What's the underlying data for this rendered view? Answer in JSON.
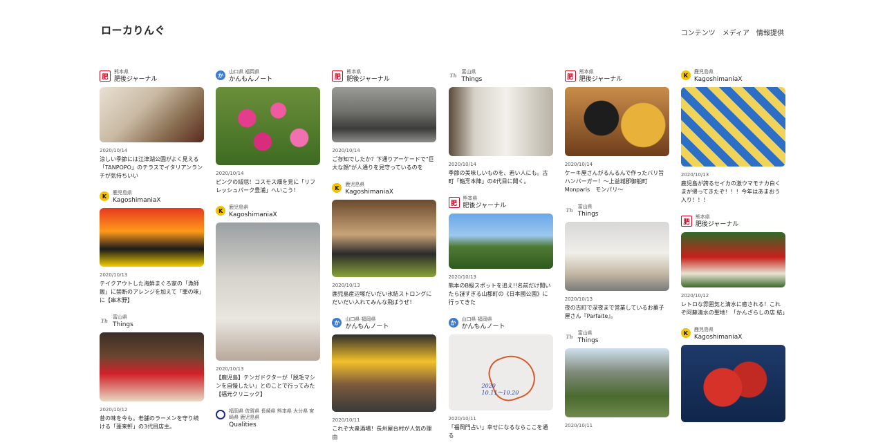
{
  "header": {
    "title": "ローカりんぐ",
    "nav": [
      "コンテンツ",
      "メディア",
      "情報提供"
    ]
  },
  "columns": [
    [
      {
        "pref": "熊本県",
        "name": "肥後ジャーナル",
        "logo": "higo",
        "date": "2020/10/14",
        "title": "涼しい季節には江津湖公園がよく見える「TANPOPO」のテラスでイタリアンランチが気持ちいい"
      },
      {
        "pref": "鹿児島県",
        "name": "KagoshimaniaX",
        "logo": "kago",
        "date": "2020/10/13",
        "title": "テイクアウトした海鮮まぐろ家の「漁師飯」に禁断のアレンジを加えて「罪の味」に【串木野】"
      },
      {
        "pref": "富山県",
        "name": "Things",
        "logo": "things",
        "date": "2020/10/12",
        "title": "昔の味を今も。老舗のラーメンを守り続ける「蓬来軒」の3代目店主。"
      }
    ],
    [
      {
        "pref": "山口県 福岡県",
        "name": "かんもんノート",
        "logo": "kanmon",
        "date": "2020/10/14",
        "title": "ピンクの絨毯！コスモス畑を見に「リフレッシュパーク豊浦」へいこう！"
      },
      {
        "pref": "鹿児島県",
        "name": "KagoshimaniaX",
        "logo": "kago",
        "date": "2020/10/13",
        "title": "【鹿児島】テンガドクターが「脱毛マシンを自慢したい」とのことで行ってみた【福元クリニック】"
      },
      {
        "pref": "福岡県 佐賀県 長崎県 熊本県 大分県 宮崎県 鹿児島県",
        "name": "Qualities",
        "logo": "qual",
        "date": "",
        "title": ""
      }
    ],
    [
      {
        "pref": "熊本県",
        "name": "肥後ジャーナル",
        "logo": "higo",
        "date": "2020/10/14",
        "title": "ご存知でしたか？下通りアーケードで\"巨大な顔\"が人通りを見守っているのを"
      },
      {
        "pref": "鹿児島県",
        "name": "KagoshimaniaX",
        "logo": "kago",
        "date": "2020/10/13",
        "title": "鹿児島産辺塚だいだい氷結ストロングにだいだい入れてみんな飛ばうぜ！"
      },
      {
        "pref": "山口県 福岡県",
        "name": "かんもんノート",
        "logo": "kanmon",
        "date": "2020/10/11",
        "title": "これぞ大衆酒場！長州屋台村が人気の理由"
      }
    ],
    [
      {
        "pref": "富山県",
        "name": "Things",
        "logo": "things",
        "date": "2020/10/14",
        "title": "季節の美味しいものを、若い人にも。古町「鮨烹本陣」の4代目に聞く。"
      },
      {
        "pref": "熊本県",
        "name": "肥後ジャーナル",
        "logo": "higo",
        "date": "2020/10/13",
        "title": "熊本のB級スポットを追え!!名前だけ聞いたら謎すぎる山都町の《日本國公園》に行ってきた"
      },
      {
        "pref": "山口県 福岡県",
        "name": "かんもんノート",
        "logo": "kanmon",
        "date": "2020/10/11",
        "title": "「福岡門占い」幸せになるならここを通る",
        "hw1": "2020",
        "hw2": "10.11〜10.20"
      }
    ],
    [
      {
        "pref": "熊本県",
        "name": "肥後ジャーナル",
        "logo": "higo",
        "date": "2020/10/14",
        "title": "ケーキ屋さんがるんるんで作ったバリ旨ハンバーガー！〜上益城郡御船町 Monparis　モンパリ〜"
      },
      {
        "pref": "富山県",
        "name": "Things",
        "logo": "things",
        "date": "2020/10/13",
        "title": "夜の古町で深夜まで営業しているお菓子屋さん『Parfaite』。"
      },
      {
        "pref": "富山県",
        "name": "Things",
        "logo": "things",
        "date": "2020/10/11",
        "title": ""
      }
    ],
    [
      {
        "pref": "鹿児島県",
        "name": "KagoshimaniaX",
        "logo": "kago",
        "date": "2020/10/13",
        "title": "鹿児島が誇るセイカの激ウマモナカ白くまが帰ってきたぞ！！！今年はあまおう入り！！！"
      },
      {
        "pref": "熊本県",
        "name": "肥後ジャーナル",
        "logo": "higo",
        "date": "2020/10/12",
        "title": "レトロな雰囲気と清水に癒される！これぞ阿蘇清水の聖地！「かんざらしの店 結」"
      },
      {
        "pref": "鹿児島県",
        "name": "KagoshimaniaX",
        "logo": "kago",
        "date": "",
        "title": ""
      }
    ]
  ]
}
